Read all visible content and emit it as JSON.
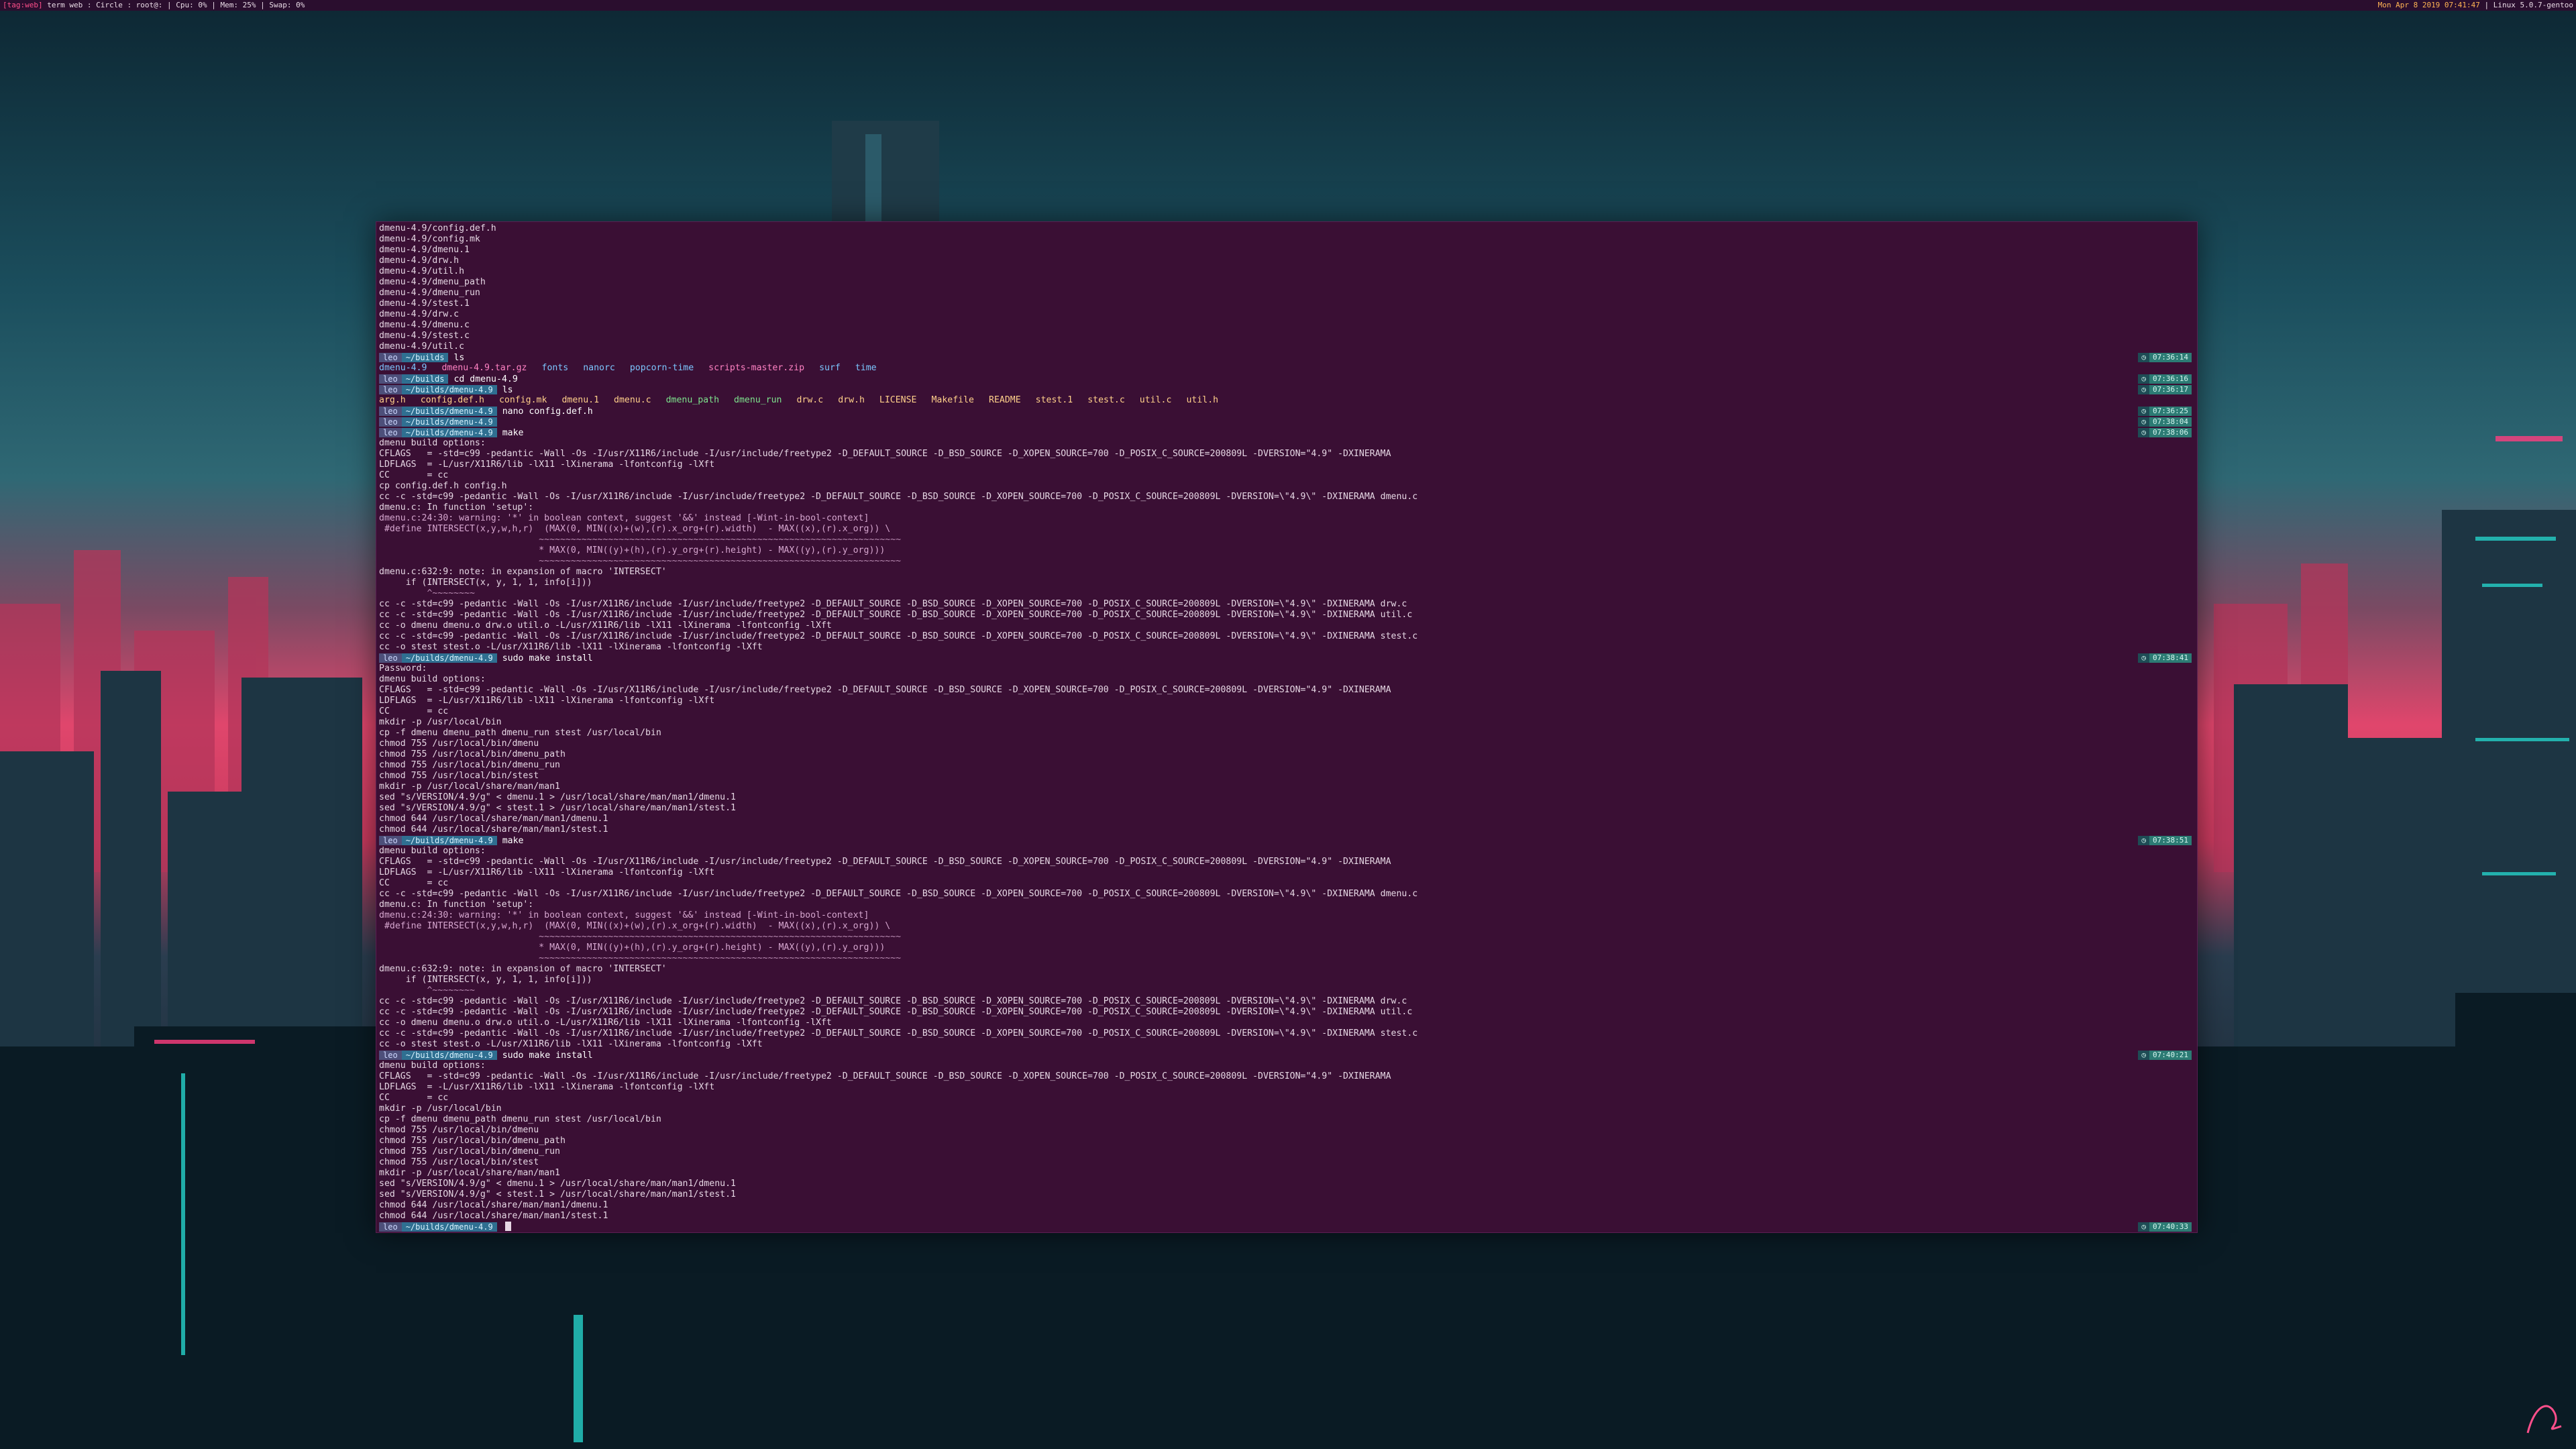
{
  "topbar": {
    "left_tag": "[tag:web]",
    "left_info": "term web : Circle : root@: | Cpu: 0% | Mem: 25% | Swap: 0%",
    "right_date": "Mon Apr  8 2019 07:41:47",
    "right_kernel": "| Linux 5.0.7-gentoo"
  },
  "colors": {
    "terminal_bg": "#3a0f34",
    "accent_pink": "#ff4f8b",
    "prompt_path": "#2f6f91",
    "time_chip": "#2c7b74"
  },
  "terminal": {
    "lines": [
      {
        "t": "dmenu-4.9/config.def.h"
      },
      {
        "t": "dmenu-4.9/config.mk"
      },
      {
        "t": "dmenu-4.9/dmenu.1"
      },
      {
        "t": "dmenu-4.9/drw.h"
      },
      {
        "t": "dmenu-4.9/util.h"
      },
      {
        "t": "dmenu-4.9/dmenu_path"
      },
      {
        "t": "dmenu-4.9/dmenu_run"
      },
      {
        "t": "dmenu-4.9/stest.1"
      },
      {
        "t": "dmenu-4.9/drw.c"
      },
      {
        "t": "dmenu-4.9/dmenu.c"
      },
      {
        "t": "dmenu-4.9/stest.c"
      },
      {
        "t": "dmenu-4.9/util.c"
      },
      {
        "prompt": true,
        "user": "leo",
        "path": "~/builds",
        "cmd": "ls",
        "time": "07:36:14"
      },
      {
        "ls": [
          "dmenu-4.9",
          "dmenu-4.9.tar.gz",
          "fonts",
          "nanorc",
          "popcorn-time",
          "scripts-master.zip",
          "surf",
          "time"
        ]
      },
      {
        "prompt": true,
        "user": "leo",
        "path": "~/builds",
        "cmd": "cd dmenu-4.9",
        "time": "07:36:16"
      },
      {
        "prompt": true,
        "user": "leo",
        "path": "~/builds/dmenu-4.9",
        "cmd": "ls",
        "time": "07:36:17"
      },
      {
        "ls": [
          "arg.h",
          "config.def.h",
          "config.mk",
          "dmenu.1",
          "dmenu.c",
          "dmenu_path",
          "dmenu_run",
          "drw.c",
          "drw.h",
          "LICENSE",
          "Makefile",
          "README",
          "stest.1",
          "stest.c",
          "util.c",
          "util.h"
        ]
      },
      {
        "prompt": true,
        "user": "leo",
        "path": "~/builds/dmenu-4.9",
        "cmd": "nano config.def.h",
        "time": "07:36:25"
      },
      {
        "prompt": true,
        "user": "leo",
        "path": "~/builds/dmenu-4.9",
        "cmd": "",
        "time": "07:38:04"
      },
      {
        "prompt": true,
        "user": "leo",
        "path": "~/builds/dmenu-4.9",
        "cmd": "make",
        "time": "07:38:06"
      },
      {
        "t": "dmenu build options:"
      },
      {
        "t": "CFLAGS   = -std=c99 -pedantic -Wall -Os -I/usr/X11R6/include -I/usr/include/freetype2 -D_DEFAULT_SOURCE -D_BSD_SOURCE -D_XOPEN_SOURCE=700 -D_POSIX_C_SOURCE=200809L -DVERSION=\"4.9\" -DXINERAMA"
      },
      {
        "t": "LDFLAGS  = -L/usr/X11R6/lib -lX11 -lXinerama -lfontconfig -lXft"
      },
      {
        "t": "CC       = cc"
      },
      {
        "t": "cp config.def.h config.h"
      },
      {
        "t": "cc -c -std=c99 -pedantic -Wall -Os -I/usr/X11R6/include -I/usr/include/freetype2 -D_DEFAULT_SOURCE -D_BSD_SOURCE -D_XOPEN_SOURCE=700 -D_POSIX_C_SOURCE=200809L -DVERSION=\\\"4.9\\\" -DXINERAMA dmenu.c"
      },
      {
        "t": "dmenu.c: In function 'setup':"
      },
      {
        "t": "dmenu.c:24:30: warning: '*' in boolean context, suggest '&&' instead [-Wint-in-bool-context]",
        "c": "warn"
      },
      {
        "t": " #define INTERSECT(x,y,w,h,r)  (MAX(0, MIN((x)+(w),(r).x_org+(r).width)  - MAX((x),(r).x_org)) \\",
        "c": "warn"
      },
      {
        "t": "                              ~~~~~~~~~~~~~~~~~~~~~~~~~~~~~~~~~~~~~~~~~~~~~~~~~~~~~~~~~~~~~~~~~~~~",
        "c": "dim"
      },
      {
        "t": "                              * MAX(0, MIN((y)+(h),(r).y_org+(r).height) - MAX((y),(r).y_org)))",
        "c": "warn"
      },
      {
        "t": "                              ~~~~~~~~~~~~~~~~~~~~~~~~~~~~~~~~~~~~~~~~~~~~~~~~~~~~~~~~~~~~~~~~~~~~",
        "c": "dim"
      },
      {
        "t": "dmenu.c:632:9: note: in expansion of macro 'INTERSECT'"
      },
      {
        "t": "     if (INTERSECT(x, y, 1, 1, info[i]))"
      },
      {
        "t": "         ^~~~~~~~~",
        "c": "dim"
      },
      {
        "t": "cc -c -std=c99 -pedantic -Wall -Os -I/usr/X11R6/include -I/usr/include/freetype2 -D_DEFAULT_SOURCE -D_BSD_SOURCE -D_XOPEN_SOURCE=700 -D_POSIX_C_SOURCE=200809L -DVERSION=\\\"4.9\\\" -DXINERAMA drw.c"
      },
      {
        "t": "cc -c -std=c99 -pedantic -Wall -Os -I/usr/X11R6/include -I/usr/include/freetype2 -D_DEFAULT_SOURCE -D_BSD_SOURCE -D_XOPEN_SOURCE=700 -D_POSIX_C_SOURCE=200809L -DVERSION=\\\"4.9\\\" -DXINERAMA util.c"
      },
      {
        "t": "cc -o dmenu dmenu.o drw.o util.o -L/usr/X11R6/lib -lX11 -lXinerama -lfontconfig -lXft"
      },
      {
        "t": "cc -c -std=c99 -pedantic -Wall -Os -I/usr/X11R6/include -I/usr/include/freetype2 -D_DEFAULT_SOURCE -D_BSD_SOURCE -D_XOPEN_SOURCE=700 -D_POSIX_C_SOURCE=200809L -DVERSION=\\\"4.9\\\" -DXINERAMA stest.c"
      },
      {
        "t": "cc -o stest stest.o -L/usr/X11R6/lib -lX11 -lXinerama -lfontconfig -lXft"
      },
      {
        "prompt": true,
        "user": "leo",
        "path": "~/builds/dmenu-4.9",
        "cmd": "sudo make install",
        "time": "07:38:41"
      },
      {
        "t": "Password:"
      },
      {
        "t": "dmenu build options:"
      },
      {
        "t": "CFLAGS   = -std=c99 -pedantic -Wall -Os -I/usr/X11R6/include -I/usr/include/freetype2 -D_DEFAULT_SOURCE -D_BSD_SOURCE -D_XOPEN_SOURCE=700 -D_POSIX_C_SOURCE=200809L -DVERSION=\"4.9\" -DXINERAMA"
      },
      {
        "t": "LDFLAGS  = -L/usr/X11R6/lib -lX11 -lXinerama -lfontconfig -lXft"
      },
      {
        "t": "CC       = cc"
      },
      {
        "t": "mkdir -p /usr/local/bin"
      },
      {
        "t": "cp -f dmenu dmenu_path dmenu_run stest /usr/local/bin"
      },
      {
        "t": "chmod 755 /usr/local/bin/dmenu"
      },
      {
        "t": "chmod 755 /usr/local/bin/dmenu_path"
      },
      {
        "t": "chmod 755 /usr/local/bin/dmenu_run"
      },
      {
        "t": "chmod 755 /usr/local/bin/stest"
      },
      {
        "t": "mkdir -p /usr/local/share/man/man1"
      },
      {
        "t": "sed \"s/VERSION/4.9/g\" < dmenu.1 > /usr/local/share/man/man1/dmenu.1"
      },
      {
        "t": "sed \"s/VERSION/4.9/g\" < stest.1 > /usr/local/share/man/man1/stest.1"
      },
      {
        "t": "chmod 644 /usr/local/share/man/man1/dmenu.1"
      },
      {
        "t": "chmod 644 /usr/local/share/man/man1/stest.1"
      },
      {
        "prompt": true,
        "user": "leo",
        "path": "~/builds/dmenu-4.9",
        "cmd": "make",
        "time": "07:38:51"
      },
      {
        "t": "dmenu build options:"
      },
      {
        "t": "CFLAGS   = -std=c99 -pedantic -Wall -Os -I/usr/X11R6/include -I/usr/include/freetype2 -D_DEFAULT_SOURCE -D_BSD_SOURCE -D_XOPEN_SOURCE=700 -D_POSIX_C_SOURCE=200809L -DVERSION=\"4.9\" -DXINERAMA"
      },
      {
        "t": "LDFLAGS  = -L/usr/X11R6/lib -lX11 -lXinerama -lfontconfig -lXft"
      },
      {
        "t": "CC       = cc"
      },
      {
        "t": "cc -c -std=c99 -pedantic -Wall -Os -I/usr/X11R6/include -I/usr/include/freetype2 -D_DEFAULT_SOURCE -D_BSD_SOURCE -D_XOPEN_SOURCE=700 -D_POSIX_C_SOURCE=200809L -DVERSION=\\\"4.9\\\" -DXINERAMA dmenu.c"
      },
      {
        "t": "dmenu.c: In function 'setup':"
      },
      {
        "t": "dmenu.c:24:30: warning: '*' in boolean context, suggest '&&' instead [-Wint-in-bool-context]",
        "c": "warn"
      },
      {
        "t": " #define INTERSECT(x,y,w,h,r)  (MAX(0, MIN((x)+(w),(r).x_org+(r).width)  - MAX((x),(r).x_org)) \\",
        "c": "warn"
      },
      {
        "t": "                              ~~~~~~~~~~~~~~~~~~~~~~~~~~~~~~~~~~~~~~~~~~~~~~~~~~~~~~~~~~~~~~~~~~~~",
        "c": "dim"
      },
      {
        "t": "                              * MAX(0, MIN((y)+(h),(r).y_org+(r).height) - MAX((y),(r).y_org)))",
        "c": "warn"
      },
      {
        "t": "                              ~~~~~~~~~~~~~~~~~~~~~~~~~~~~~~~~~~~~~~~~~~~~~~~~~~~~~~~~~~~~~~~~~~~~",
        "c": "dim"
      },
      {
        "t": "dmenu.c:632:9: note: in expansion of macro 'INTERSECT'"
      },
      {
        "t": "     if (INTERSECT(x, y, 1, 1, info[i]))"
      },
      {
        "t": "         ^~~~~~~~~",
        "c": "dim"
      },
      {
        "t": "cc -c -std=c99 -pedantic -Wall -Os -I/usr/X11R6/include -I/usr/include/freetype2 -D_DEFAULT_SOURCE -D_BSD_SOURCE -D_XOPEN_SOURCE=700 -D_POSIX_C_SOURCE=200809L -DVERSION=\\\"4.9\\\" -DXINERAMA drw.c"
      },
      {
        "t": "cc -c -std=c99 -pedantic -Wall -Os -I/usr/X11R6/include -I/usr/include/freetype2 -D_DEFAULT_SOURCE -D_BSD_SOURCE -D_XOPEN_SOURCE=700 -D_POSIX_C_SOURCE=200809L -DVERSION=\\\"4.9\\\" -DXINERAMA util.c"
      },
      {
        "t": "cc -o dmenu dmenu.o drw.o util.o -L/usr/X11R6/lib -lX11 -lXinerama -lfontconfig -lXft"
      },
      {
        "t": "cc -c -std=c99 -pedantic -Wall -Os -I/usr/X11R6/include -I/usr/include/freetype2 -D_DEFAULT_SOURCE -D_BSD_SOURCE -D_XOPEN_SOURCE=700 -D_POSIX_C_SOURCE=200809L -DVERSION=\\\"4.9\\\" -DXINERAMA stest.c"
      },
      {
        "t": "cc -o stest stest.o -L/usr/X11R6/lib -lX11 -lXinerama -lfontconfig -lXft"
      },
      {
        "prompt": true,
        "user": "leo",
        "path": "~/builds/dmenu-4.9",
        "cmd": "sudo make install",
        "time": "07:40:21"
      },
      {
        "t": "dmenu build options:"
      },
      {
        "t": "CFLAGS   = -std=c99 -pedantic -Wall -Os -I/usr/X11R6/include -I/usr/include/freetype2 -D_DEFAULT_SOURCE -D_BSD_SOURCE -D_XOPEN_SOURCE=700 -D_POSIX_C_SOURCE=200809L -DVERSION=\"4.9\" -DXINERAMA"
      },
      {
        "t": "LDFLAGS  = -L/usr/X11R6/lib -lX11 -lXinerama -lfontconfig -lXft"
      },
      {
        "t": "CC       = cc"
      },
      {
        "t": "mkdir -p /usr/local/bin"
      },
      {
        "t": "cp -f dmenu dmenu_path dmenu_run stest /usr/local/bin"
      },
      {
        "t": "chmod 755 /usr/local/bin/dmenu"
      },
      {
        "t": "chmod 755 /usr/local/bin/dmenu_path"
      },
      {
        "t": "chmod 755 /usr/local/bin/dmenu_run"
      },
      {
        "t": "chmod 755 /usr/local/bin/stest"
      },
      {
        "t": "mkdir -p /usr/local/share/man/man1"
      },
      {
        "t": "sed \"s/VERSION/4.9/g\" < dmenu.1 > /usr/local/share/man/man1/dmenu.1"
      },
      {
        "t": "sed \"s/VERSION/4.9/g\" < stest.1 > /usr/local/share/man/man1/stest.1"
      },
      {
        "t": "chmod 644 /usr/local/share/man/man1/dmenu.1"
      },
      {
        "t": "chmod 644 /usr/local/share/man/man1/stest.1"
      },
      {
        "prompt": true,
        "user": "leo",
        "path": "~/builds/dmenu-4.9",
        "cmd": "",
        "time": "07:40:33",
        "cursor": true
      }
    ]
  }
}
